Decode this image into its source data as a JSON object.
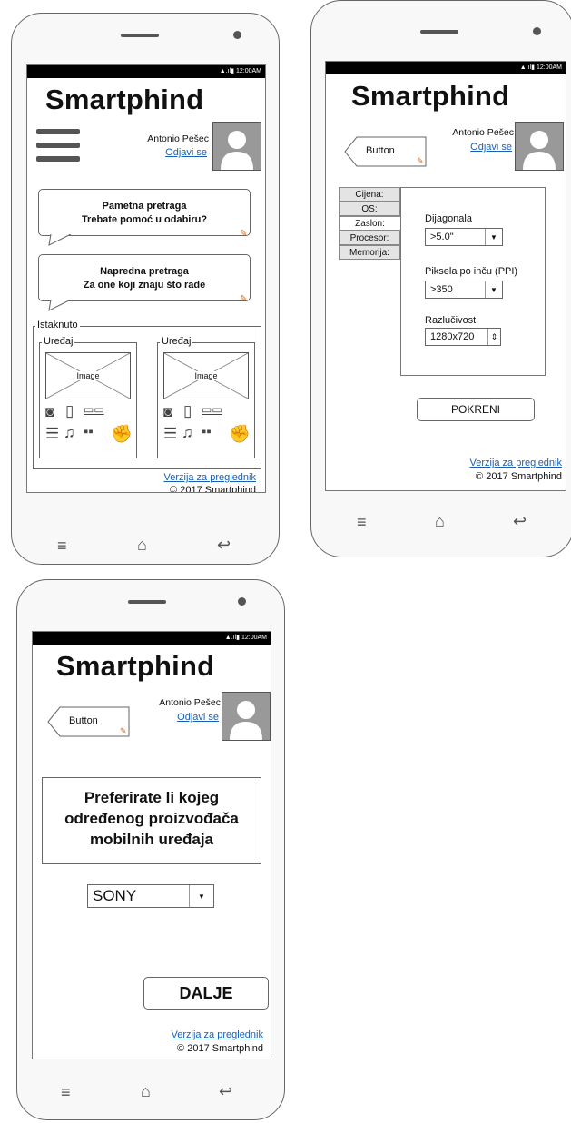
{
  "status_bar": {
    "time": "12:00AM"
  },
  "app": {
    "title": "Smartphind"
  },
  "user": {
    "name": "Antonio Pešec",
    "logout": "Odjavi se"
  },
  "footer": {
    "browser_version": "Verzija za preglednik",
    "copyright": "2017 Smartphind"
  },
  "nav": {
    "menu_icon": "menu-lines-icon",
    "home_icon": "home-icon",
    "back_icon": "back-arrow-icon"
  },
  "screen1": {
    "smart_search": {
      "line1": "Pametna pretraga",
      "line2": "Trebate pomoć u odabiru?"
    },
    "advanced_search": {
      "line1": "Napredna pretraga",
      "line2": "Za one koji znaju što rade"
    },
    "featured": {
      "legend": "Istaknuto",
      "devices": [
        {
          "legend": "Uređaj",
          "image_label": "Image"
        },
        {
          "legend": "Uređaj",
          "image_label": "Image"
        }
      ],
      "feature_icons": [
        "camera-icon",
        "phone-icon",
        "battery-icon",
        "storage-icon",
        "music-icon",
        "android-icon",
        "thumbs-up-icon"
      ]
    }
  },
  "screen2": {
    "back_button": "Button",
    "tabs": [
      "Cijena:",
      "OS:",
      "Zaslon:",
      "Procesor:",
      "Memorija:"
    ],
    "active_tab": "Zaslon:",
    "fields": {
      "diagonal": {
        "label": "Dijagonala",
        "value": ">5.0\""
      },
      "ppi": {
        "label": "Piksela po inču (PPI)",
        "value": ">350"
      },
      "resolution": {
        "label": "Razlučivost",
        "value": "1280x720"
      }
    },
    "run_button": "POKRENI"
  },
  "screen3": {
    "back_button": "Button",
    "question": {
      "line1": "Preferirate li kojeg",
      "line2": "određenog proizvođača",
      "line3": "mobilnih uređaja"
    },
    "manufacturer": "SONY",
    "next_button": "DALJE"
  }
}
